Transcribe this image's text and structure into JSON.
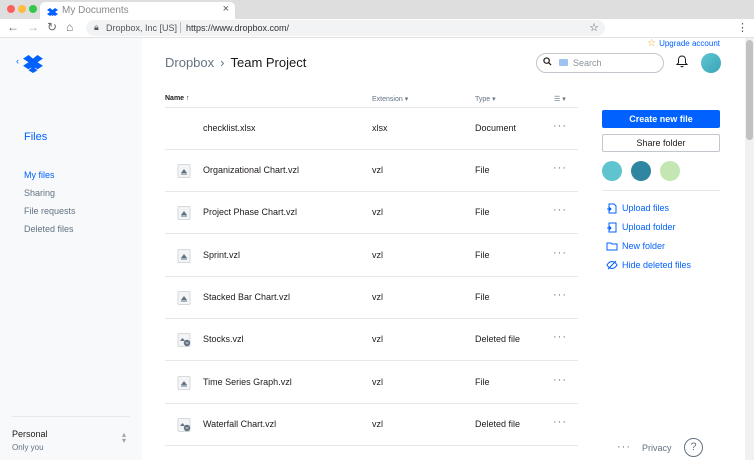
{
  "browser": {
    "tab_title": "My Documents",
    "site_identity": "Dropbox, Inc [US]",
    "url": "https://www.dropbox.com/"
  },
  "sidebar": {
    "section_title": "Files",
    "items": [
      {
        "label": "My files",
        "active": true
      },
      {
        "label": "Sharing",
        "active": false
      },
      {
        "label": "File requests",
        "active": false
      },
      {
        "label": "Deleted files",
        "active": false
      }
    ],
    "account_name": "Personal",
    "account_sub": "Only you"
  },
  "header": {
    "upgrade_label": "Upgrade account",
    "breadcrumb_parent": "Dropbox",
    "breadcrumb_current": "Team Project",
    "search_placeholder": "Search"
  },
  "table": {
    "columns": {
      "name": "Name",
      "extension": "Extension",
      "type": "Type"
    },
    "rows": [
      {
        "name": "checklist.xlsx",
        "extension": "xlsx",
        "type": "Document",
        "icon": "none"
      },
      {
        "name": "Organizational Chart.vzl",
        "extension": "vzl",
        "type": "File",
        "icon": "vzl-file-icon"
      },
      {
        "name": "Project Phase Chart.vzl",
        "extension": "vzl",
        "type": "File",
        "icon": "vzl-file-icon"
      },
      {
        "name": "Sprint.vzl",
        "extension": "vzl",
        "type": "File",
        "icon": "vzl-file-icon"
      },
      {
        "name": "Stacked Bar Chart.vzl",
        "extension": "vzl",
        "type": "File",
        "icon": "vzl-file-icon"
      },
      {
        "name": "Stocks.vzl",
        "extension": "vzl",
        "type": "Deleted file",
        "icon": "deleted-file-icon"
      },
      {
        "name": "Time Series Graph.vzl",
        "extension": "vzl",
        "type": "File",
        "icon": "vzl-file-icon"
      },
      {
        "name": "Waterfall Chart.vzl",
        "extension": "vzl",
        "type": "Deleted file",
        "icon": "deleted-file-icon"
      }
    ]
  },
  "panel": {
    "create_label": "Create new file",
    "share_label": "Share folder",
    "member_colors": [
      "#5fc4d0",
      "#2e86a0",
      "#c3e6b3"
    ],
    "actions": [
      {
        "label": "Upload files",
        "icon": "upload-files-icon"
      },
      {
        "label": "Upload folder",
        "icon": "upload-folder-icon"
      },
      {
        "label": "New folder",
        "icon": "new-folder-icon"
      },
      {
        "label": "Hide deleted files",
        "icon": "hide-deleted-icon"
      }
    ]
  },
  "footer": {
    "privacy_label": "Privacy",
    "help_label": "?"
  },
  "colors": {
    "accent": "#0061fe",
    "sidebar_bg": "#f7f9fa"
  }
}
